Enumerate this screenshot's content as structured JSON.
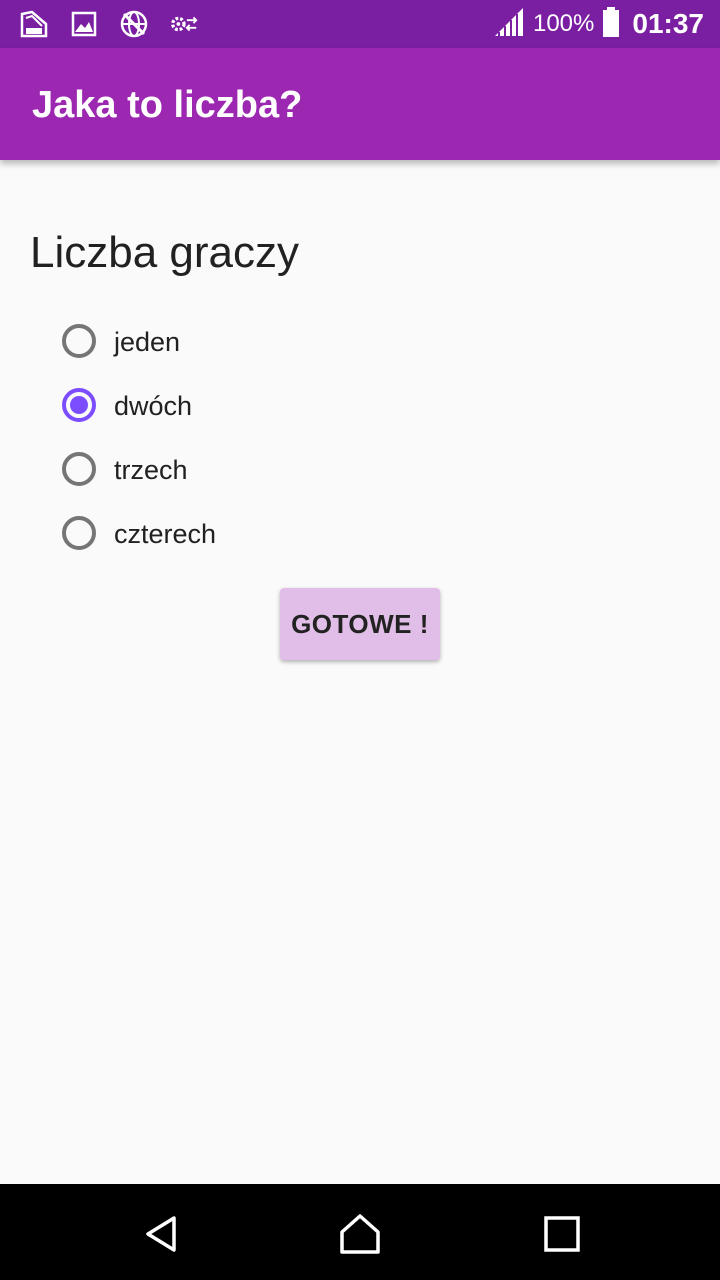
{
  "status_bar": {
    "battery_percent": "100%",
    "time": "01:37",
    "icons": [
      "notification-app-icon",
      "gallery-icon",
      "vpn-globe-icon",
      "settings-sync-icon",
      "signal-icon",
      "battery-icon"
    ]
  },
  "app_bar": {
    "title": "Jaka to liczba?"
  },
  "main": {
    "section_title": "Liczba graczy",
    "options": [
      {
        "label": "jeden",
        "checked": false
      },
      {
        "label": "dwóch",
        "checked": true
      },
      {
        "label": "trzech",
        "checked": false
      },
      {
        "label": "czterech",
        "checked": false
      }
    ],
    "done_label": "GOTOWE !"
  },
  "colors": {
    "status_bar": "#7b1fa2",
    "app_bar": "#9c27b0",
    "accent": "#7c4dff",
    "button_bg": "#e1bee7"
  }
}
